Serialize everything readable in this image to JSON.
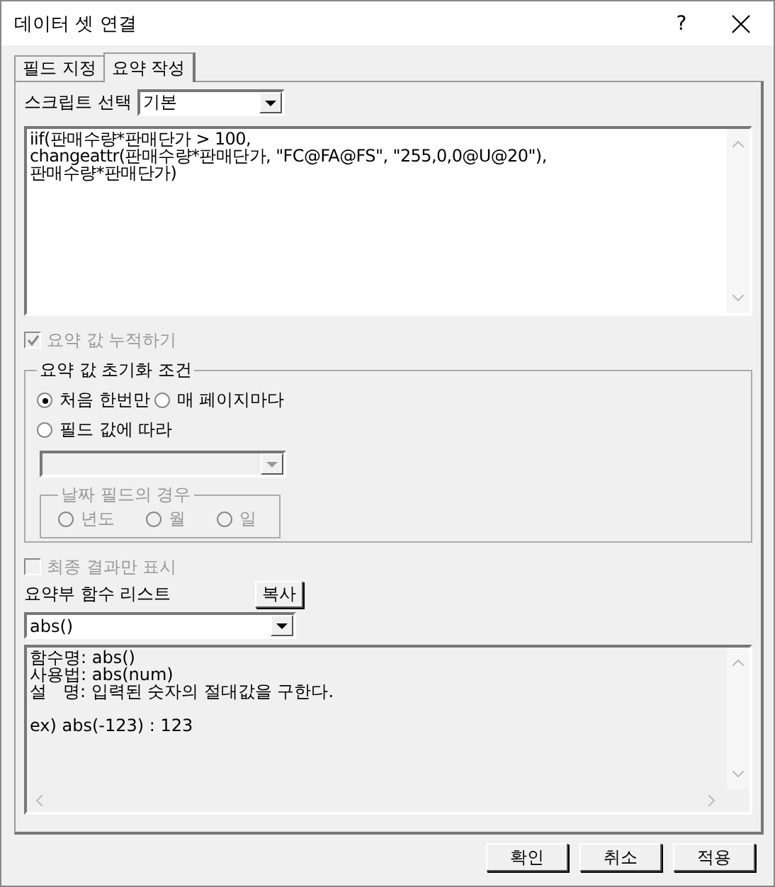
{
  "window": {
    "title": "데이터 셋 연결",
    "help": "?"
  },
  "tabs": [
    {
      "label": "필드 지정",
      "selected": false
    },
    {
      "label": "요약 작성",
      "selected": true
    }
  ],
  "script_select": {
    "label": "스크립트 선택",
    "value": "기본"
  },
  "script_lines": [
    "iif(판매수량*판매단가 > 100,",
    "changeattr(판매수량*판매단가, \"FC@FA@FS\", \"255,0,0@U@20\"),",
    "판매수량*판매단가)"
  ],
  "accumulate": {
    "label": "요약 값 누적하기",
    "checked": true,
    "disabled": true
  },
  "reset_group": {
    "title": "요약 값 초기화 조건",
    "options": [
      {
        "label": "처음 한번만",
        "selected": true
      },
      {
        "label": "매 페이지마다",
        "selected": false
      },
      {
        "label": "필드 값에 따라",
        "selected": false
      }
    ],
    "field_combo": {
      "disabled": true
    },
    "date_group": {
      "title": "날짜 필드의 경우",
      "disabled": true,
      "options": [
        {
          "label": "년도",
          "selected": false
        },
        {
          "label": "월",
          "selected": false
        },
        {
          "label": "일",
          "selected": false
        }
      ]
    }
  },
  "final_only": {
    "label": "최종 결과만 표시",
    "checked": false,
    "disabled": true
  },
  "function_list": {
    "label": "요약부 함수 리스트",
    "copy_button": "복사",
    "value": "abs()"
  },
  "description_lines": [
    "함수명: abs()",
    "사용법: abs(num)",
    "설   명: 입력된 숫자의 절대값을 구한다."
  ],
  "example": "ex) abs(-123) : 123",
  "buttons": [
    "확인",
    "취소",
    "적용"
  ]
}
